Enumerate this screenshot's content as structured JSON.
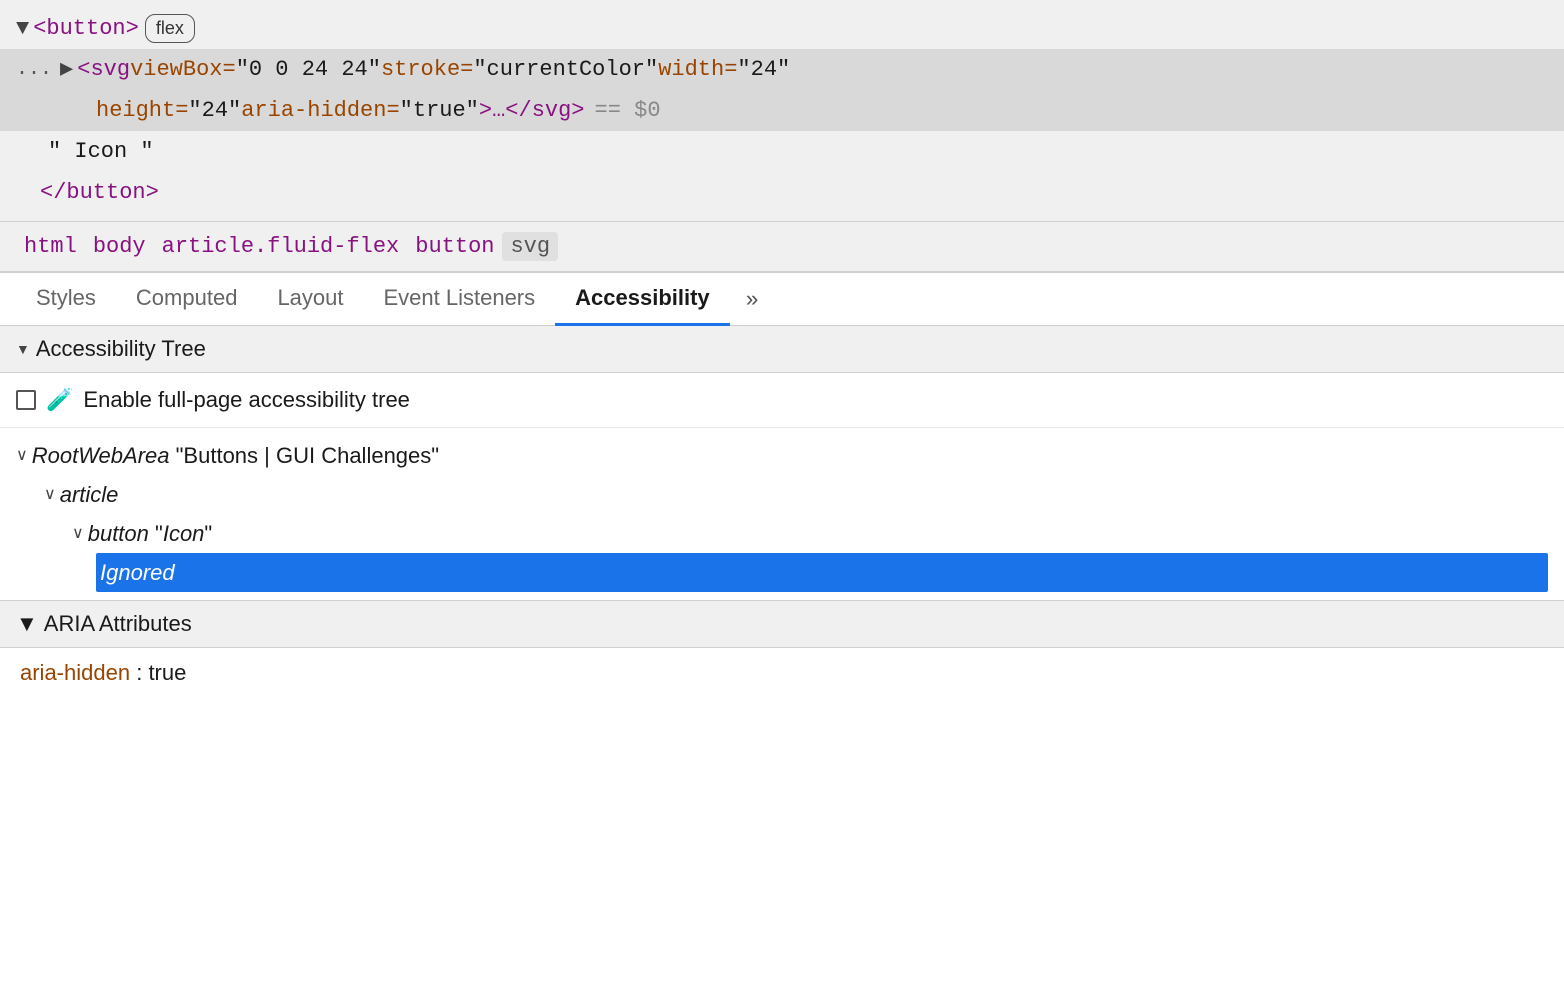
{
  "dom": {
    "button_line": {
      "arrow": "▼",
      "tag_open": "<button>",
      "badge": "flex"
    },
    "svg_line": {
      "dots": "...",
      "arrow": "▶",
      "code": "<svg viewBox=\"0 0 24 24\" stroke=\"currentColor\" width=\"24\"",
      "attr_height": "height=\"24\"",
      "attr_aria": "aria-hidden=\"true\">…</svg>",
      "dollar": "== $0"
    },
    "text_node": "\" Icon \"",
    "button_close": "</button>"
  },
  "breadcrumb": {
    "items": [
      {
        "label": "html",
        "active": false
      },
      {
        "label": "body",
        "active": false
      },
      {
        "label": "article.fluid-flex",
        "active": false
      },
      {
        "label": "button",
        "active": false
      },
      {
        "label": "svg",
        "active": true
      }
    ]
  },
  "tabs": {
    "items": [
      {
        "label": "Styles",
        "active": false
      },
      {
        "label": "Computed",
        "active": false
      },
      {
        "label": "Layout",
        "active": false
      },
      {
        "label": "Event Listeners",
        "active": false
      },
      {
        "label": "Accessibility",
        "active": true
      },
      {
        "label": "»",
        "active": false
      }
    ]
  },
  "accessibility_tree": {
    "section_title": "Accessibility Tree",
    "enable_label": "Enable full-page accessibility tree",
    "nodes": [
      {
        "indent": 1,
        "chevron": "∨",
        "type": "RootWebArea",
        "value": "\"Buttons | GUI Challenges\"",
        "selected": false
      },
      {
        "indent": 2,
        "chevron": "∨",
        "type": "article",
        "value": "",
        "selected": false
      },
      {
        "indent": 3,
        "chevron": "∨",
        "type": "button",
        "value": "\"Icon\"",
        "selected": false
      },
      {
        "indent": 4,
        "chevron": "",
        "type": "Ignored",
        "value": "",
        "selected": true
      }
    ]
  },
  "aria_attributes": {
    "section_title": "ARIA Attributes",
    "items": [
      {
        "name": "aria-hidden",
        "value": "true"
      }
    ]
  }
}
